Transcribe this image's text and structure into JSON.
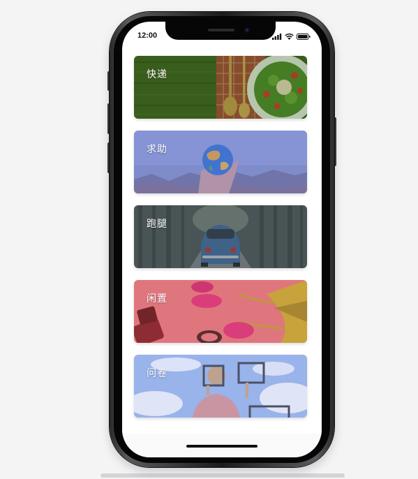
{
  "status_bar": {
    "time": "12:00",
    "icons": [
      "signal-icon",
      "wifi-icon",
      "battery-icon"
    ]
  },
  "cards": [
    {
      "label": "快递",
      "image": "wooden-table-salad-photo",
      "tint": "#2e4d14"
    },
    {
      "label": "求助",
      "image": "hand-holding-globe-photo",
      "tint": "#7f8fd0"
    },
    {
      "label": "跑腿",
      "image": "blue-beetle-car-forest-road-photo",
      "tint": "#4a5055"
    },
    {
      "label": "闲置",
      "image": "pink-tulips-coral-background-photo",
      "tint": "#e0707a"
    },
    {
      "label": "问卷",
      "image": "person-with-frames-in-clouds-photo",
      "tint": "#8fa8e8"
    }
  ]
}
